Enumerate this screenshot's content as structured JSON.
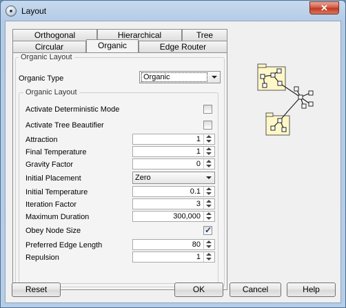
{
  "window": {
    "title": "Layout",
    "close_symbol": "✕"
  },
  "tabs": {
    "row1": [
      "Orthogonal",
      "Hierarchical",
      "Tree"
    ],
    "row2": [
      "Circular",
      "Organic",
      "Edge Router"
    ],
    "active": "Organic"
  },
  "panel": {
    "group_title": "Organic Layout",
    "organic_type_label": "Organic Type",
    "organic_type_value": "Organic",
    "inner_group_title": "Organic Layout",
    "fields": {
      "deterministic_label": "Activate Deterministic Mode",
      "tree_beautifier_label": "Activate Tree Beautifier",
      "attraction_label": "Attraction",
      "attraction_value": "1",
      "final_temp_label": "Final Temperature",
      "final_temp_value": "1",
      "gravity_label": "Gravity Factor",
      "gravity_value": "0",
      "initial_placement_label": "Initial Placement",
      "initial_placement_value": "Zero",
      "initial_temp_label": "Initial Temperature",
      "initial_temp_value": "0.1",
      "iteration_label": "Iteration Factor",
      "iteration_value": "3",
      "max_duration_label": "Maximum Duration",
      "max_duration_value": "300,000",
      "obey_node_size_label": "Obey Node Size",
      "preferred_edge_label": "Preferred Edge Length",
      "preferred_edge_value": "80",
      "repulsion_label": "Repulsion",
      "repulsion_value": "1"
    },
    "checks": {
      "deterministic": false,
      "tree_beautifier": false,
      "obey_node_size": true
    }
  },
  "buttons": {
    "reset": "Reset",
    "ok": "OK",
    "cancel": "Cancel",
    "help": "Help"
  }
}
